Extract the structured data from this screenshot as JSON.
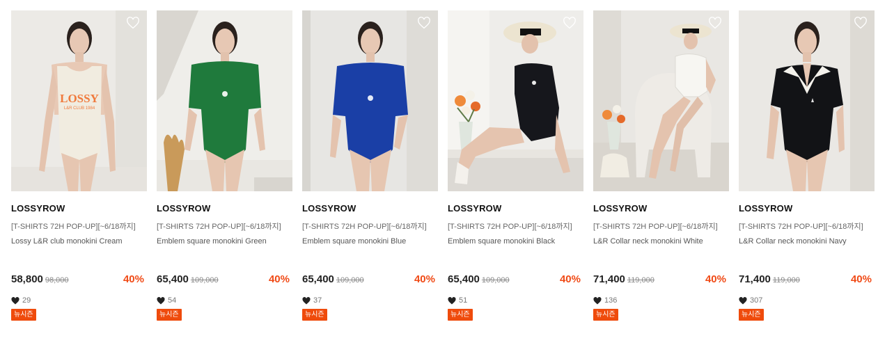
{
  "colors": {
    "discount": "#f04a16",
    "badge_bg": "#ef4b0c",
    "badge_text": "#ffffff"
  },
  "products": [
    {
      "brand": "LOSSYROW",
      "promo": "[T-SHIRTS 72H POP-UP][~6/18까지]",
      "name": "Lossy L&R club monokini Cream",
      "price": "58,800",
      "original_price": "98,000",
      "discount": "40%",
      "likes": "29",
      "badge": "뉴시즌",
      "suit_color": "#f1ece0",
      "suit_logo_text": "LOSSY",
      "suit_logo_subtext": "L&R CLUB 1984",
      "wishlist_icon": "heart-outline-icon"
    },
    {
      "brand": "LOSSYROW",
      "promo": "[T-SHIRTS 72H POP-UP][~6/18까지]",
      "name": "Emblem square monokini Green",
      "price": "65,400",
      "original_price": "109,000",
      "discount": "40%",
      "likes": "54",
      "badge": "뉴시즌",
      "suit_color": "#1f7a3c",
      "wishlist_icon": "heart-outline-icon"
    },
    {
      "brand": "LOSSYROW",
      "promo": "[T-SHIRTS 72H POP-UP][~6/18까지]",
      "name": "Emblem square monokini Blue",
      "price": "65,400",
      "original_price": "109,000",
      "discount": "40%",
      "likes": "37",
      "badge": "뉴시즌",
      "suit_color": "#1a3fa6",
      "wishlist_icon": "heart-outline-icon"
    },
    {
      "brand": "LOSSYROW",
      "promo": "[T-SHIRTS 72H POP-UP][~6/18까지]",
      "name": "Emblem square monokini Black",
      "price": "65,400",
      "original_price": "109,000",
      "discount": "40%",
      "likes": "51",
      "badge": "뉴시즌",
      "suit_color": "#16171c",
      "wishlist_icon": "heart-outline-icon"
    },
    {
      "brand": "LOSSYROW",
      "promo": "[T-SHIRTS 72H POP-UP][~6/18까지]",
      "name": "L&R Collar neck monokini White",
      "price": "71,400",
      "original_price": "119,000",
      "discount": "40%",
      "likes": "136",
      "badge": "뉴시즌",
      "suit_color": "#f7f6f2",
      "wishlist_icon": "heart-outline-icon"
    },
    {
      "brand": "LOSSYROW",
      "promo": "[T-SHIRTS 72H POP-UP][~6/18까지]",
      "name": "L&R Collar neck monokini Navy",
      "price": "71,400",
      "original_price": "119,000",
      "discount": "40%",
      "likes": "307",
      "badge": "뉴시즌",
      "suit_color": "#121316",
      "wishlist_icon": "heart-outline-icon"
    }
  ]
}
